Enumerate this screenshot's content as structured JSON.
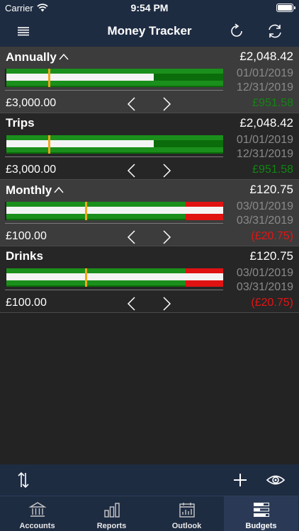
{
  "status": {
    "carrier": "Carrier",
    "time": "9:54 PM"
  },
  "nav": {
    "title": "Money Tracker",
    "menu_icon": "menu-icon",
    "refresh_icon": "refresh-icon",
    "sync_icon": "sync-icon"
  },
  "colors": {
    "bar_dark": "#0b6c0b",
    "bar_light": "#1b8f1b",
    "positive": "#128512",
    "negative": "#e41414",
    "marker": "#f0a818"
  },
  "budgets": [
    {
      "name": "Annually",
      "expandable": true,
      "spent": "£2,048.42",
      "start_date": "01/01/2019",
      "end_date": "12/31/2019",
      "amount": "£3,000.00",
      "remaining": "£951.58",
      "progress": 0.683,
      "today": 0.198,
      "over": false
    },
    {
      "name": "Trips",
      "expandable": false,
      "spent": "£2,048.42",
      "start_date": "01/01/2019",
      "end_date": "12/31/2019",
      "amount": "£3,000.00",
      "remaining": "£951.58",
      "progress": 0.683,
      "today": 0.198,
      "over": false
    },
    {
      "name": "Monthly",
      "expandable": true,
      "spent": "£120.75",
      "start_date": "03/01/2019",
      "end_date": "03/31/2019",
      "amount": "£100.00",
      "remaining": "(£20.75)",
      "progress": 1.2075,
      "today": 0.366,
      "over": true
    },
    {
      "name": "Drinks",
      "expandable": false,
      "spent": "£120.75",
      "start_date": "03/01/2019",
      "end_date": "03/31/2019",
      "amount": "£100.00",
      "remaining": "(£20.75)",
      "progress": 1.2075,
      "today": 0.366,
      "over": true
    }
  ],
  "toolbar": {
    "sort_icon": "sort-arrows-icon",
    "add_icon": "plus-icon",
    "view_icon": "eye-icon"
  },
  "tabs": [
    {
      "label": "Accounts",
      "icon": "bank-icon",
      "active": false
    },
    {
      "label": "Reports",
      "icon": "bar-chart-icon",
      "active": false
    },
    {
      "label": "Outlook",
      "icon": "calendar-chart-icon",
      "active": false
    },
    {
      "label": "Budgets",
      "icon": "budget-bars-icon",
      "active": true
    }
  ]
}
